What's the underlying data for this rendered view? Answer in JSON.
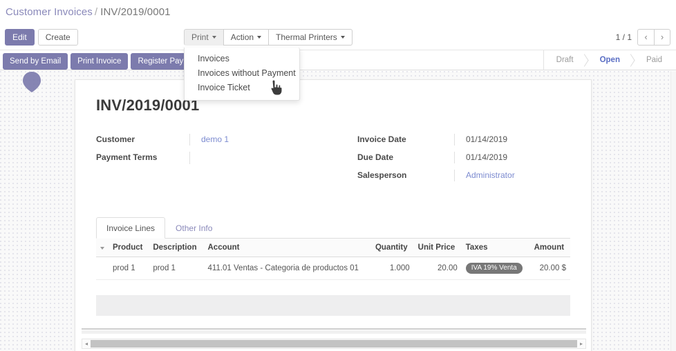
{
  "breadcrumb": {
    "parent": "Customer Invoices",
    "separator": "/",
    "current": "INV/2019/0001"
  },
  "control_panel": {
    "edit_label": "Edit",
    "create_label": "Create",
    "print_label": "Print",
    "action_label": "Action",
    "thermal_printers_label": "Thermal Printers",
    "pager_count": "1 / 1",
    "prev_icon": "‹",
    "next_icon": "›"
  },
  "print_dropdown": {
    "open": true,
    "items": [
      {
        "label": "Invoices"
      },
      {
        "label": "Invoices without Payment"
      },
      {
        "label": "Invoice Ticket"
      }
    ]
  },
  "status_bar": {
    "buttons": [
      {
        "label": "Send by Email",
        "style": "primary"
      },
      {
        "label": "Print Invoice",
        "style": "primary"
      },
      {
        "label": "Register Payment",
        "style": "primary"
      }
    ],
    "stages": [
      {
        "label": "Draft",
        "active": false
      },
      {
        "label": "Open",
        "active": true
      },
      {
        "label": "Paid",
        "active": false
      }
    ]
  },
  "form": {
    "title": "INV/2019/0001",
    "left_fields": [
      {
        "label": "Customer",
        "value": "demo 1",
        "type": "link"
      },
      {
        "label": "Payment Terms",
        "value": "",
        "type": "text"
      }
    ],
    "right_fields": [
      {
        "label": "Invoice Date",
        "value": "01/14/2019",
        "type": "text"
      },
      {
        "label": "Due Date",
        "value": "01/14/2019",
        "type": "text"
      },
      {
        "label": "Salesperson",
        "value": "Administrator",
        "type": "link"
      }
    ]
  },
  "notebook": {
    "tabs": [
      {
        "label": "Invoice Lines",
        "active": true
      },
      {
        "label": "Other Info",
        "active": false
      }
    ]
  },
  "lines_table": {
    "columns": [
      "Product",
      "Description",
      "Account",
      "Quantity",
      "Unit Price",
      "Taxes",
      "Amount"
    ],
    "rows": [
      {
        "product": "prod 1",
        "description": "prod 1",
        "account": "411.01 Ventas - Categoria de productos 01",
        "quantity": "1.000",
        "unit_price": "20.00",
        "taxes": "IVA 19% Venta",
        "amount": "20.00 $"
      }
    ]
  },
  "scrollbar": {
    "left_arrow": "◂",
    "right_arrow": "▸"
  },
  "colors": {
    "brand_purple": "#7c7bad",
    "link_blue": "#8a89ba",
    "active_stage": "#5a6ec4",
    "tag_gray": "#777777"
  }
}
